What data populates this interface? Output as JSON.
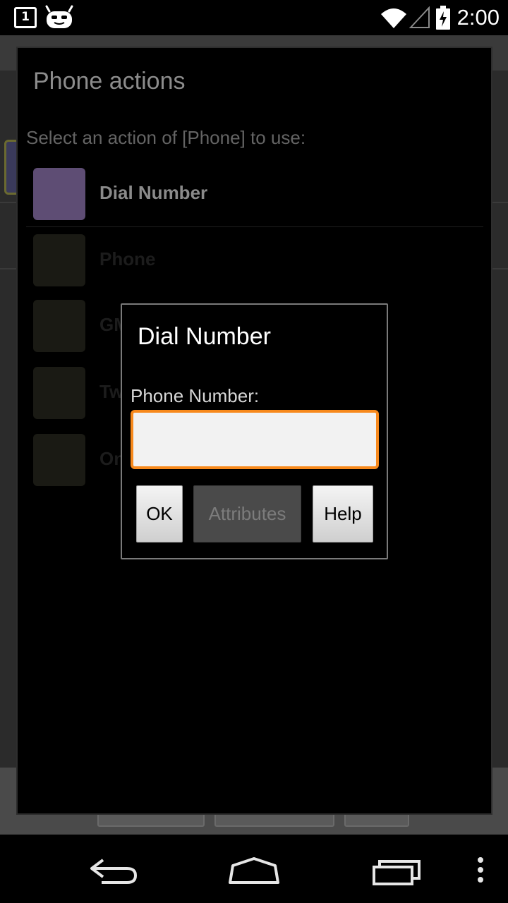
{
  "status_bar": {
    "notification_count": "1",
    "time": "2:00",
    "icons": [
      "notification-calendar-icon",
      "android-bot-icon",
      "wifi-icon",
      "cell-signal-icon",
      "battery-charging-icon"
    ]
  },
  "actions_dialog": {
    "title": "Phone actions",
    "prompt": "Select an action of [Phone] to use:",
    "items": [
      {
        "label": "Dial Number",
        "thumb_color": "#5e4d74"
      },
      {
        "label": "Phone"
      },
      {
        "label": "GM"
      },
      {
        "label": "Tw"
      },
      {
        "label": "On"
      }
    ]
  },
  "dial_dialog": {
    "title": "Dial Number",
    "field_label": "Phone Number:",
    "field_value": "",
    "field_placeholder": "",
    "buttons": {
      "ok": "OK",
      "attributes": "Attributes",
      "help": "Help"
    },
    "accent_color": "#f7891c"
  },
  "nav_bar": {
    "icons": [
      "back-icon",
      "home-icon",
      "recent-apps-icon",
      "overflow-menu-icon"
    ]
  }
}
